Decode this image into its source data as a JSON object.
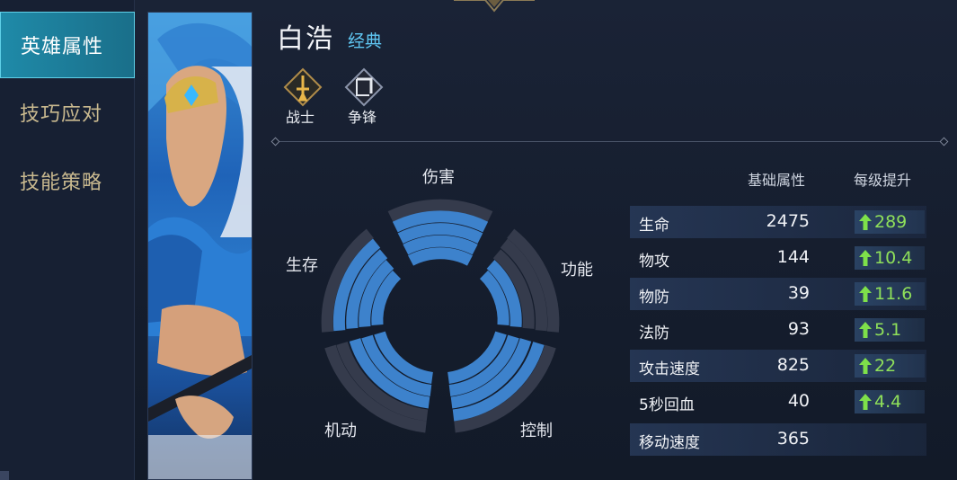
{
  "nav": {
    "items": [
      {
        "label": "英雄属性",
        "active": true
      },
      {
        "label": "技巧应对",
        "active": false
      },
      {
        "label": "技能策略",
        "active": false
      }
    ]
  },
  "hero": {
    "name": "白浩",
    "skin": "经典",
    "roles": [
      {
        "label": "战士",
        "icon": "sword-icon"
      },
      {
        "label": "争锋",
        "icon": "lane-icon"
      }
    ]
  },
  "radar": {
    "labels": {
      "damage": "伤害",
      "utility": "功能",
      "control": "控制",
      "mobility": "机动",
      "survival": "生存"
    }
  },
  "stats": {
    "base_header": "基础属性",
    "growth_header": "每级提升",
    "rows": [
      {
        "name": "生命",
        "base": "2475",
        "growth": "289"
      },
      {
        "name": "物攻",
        "base": "144",
        "growth": "10.4"
      },
      {
        "name": "物防",
        "base": "39",
        "growth": "11.6"
      },
      {
        "name": "法防",
        "base": "93",
        "growth": "5.1"
      },
      {
        "name": "攻击速度",
        "base": "825",
        "growth": "22"
      },
      {
        "name": "5秒回血",
        "base": "40",
        "growth": "4.4"
      },
      {
        "name": "移动速度",
        "base": "365",
        "growth": ""
      }
    ]
  },
  "colors": {
    "accent": "#1f8aa8",
    "skin_text": "#5fc6f2",
    "growth_text": "#8fe05a",
    "radar_fill": "#3d82cc",
    "radar_empty": "#353b4c"
  }
}
